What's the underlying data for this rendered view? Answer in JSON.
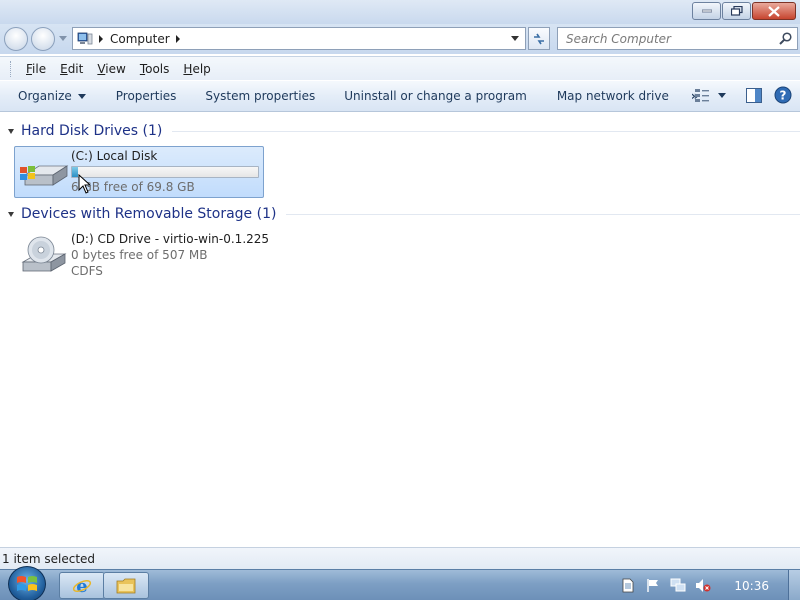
{
  "window": {
    "minimize_label": "Minimize",
    "maximize_label": "Restore",
    "close_label": "Close"
  },
  "address": {
    "location": "Computer"
  },
  "search": {
    "placeholder": "Search Computer"
  },
  "menu": {
    "items": [
      {
        "access": "F",
        "rest": "ile"
      },
      {
        "access": "E",
        "rest": "dit"
      },
      {
        "access": "V",
        "rest": "iew"
      },
      {
        "access": "T",
        "rest": "ools"
      },
      {
        "access": "H",
        "rest": "elp"
      }
    ]
  },
  "commands": {
    "organize": "Organize",
    "properties": "Properties",
    "system_properties": "System properties",
    "uninstall": "Uninstall or change a program",
    "map_drive": "Map network drive",
    "more": "»"
  },
  "groups": {
    "hard_disk": {
      "title": "Hard Disk Drives (1)",
      "drives": [
        {
          "name": "(C:) Local Disk",
          "free_text": "6⁠  GB free of 69.8 GB",
          "used_fraction": 0.03,
          "selected": true
        }
      ]
    },
    "removable": {
      "title": "Devices with Removable Storage (1)",
      "drives": [
        {
          "name": "(D:) CD Drive - virtio-win-0.1.225",
          "free_text": "0 bytes free of 507 MB",
          "filesystem": "CDFS"
        }
      ]
    }
  },
  "status": {
    "text": "1 item selected"
  },
  "taskbar": {
    "clock": "10:36"
  },
  "colors": {
    "group_title": "#1e3287",
    "selection": "#c1dcfc",
    "taskbar": "#7d9fc4"
  }
}
